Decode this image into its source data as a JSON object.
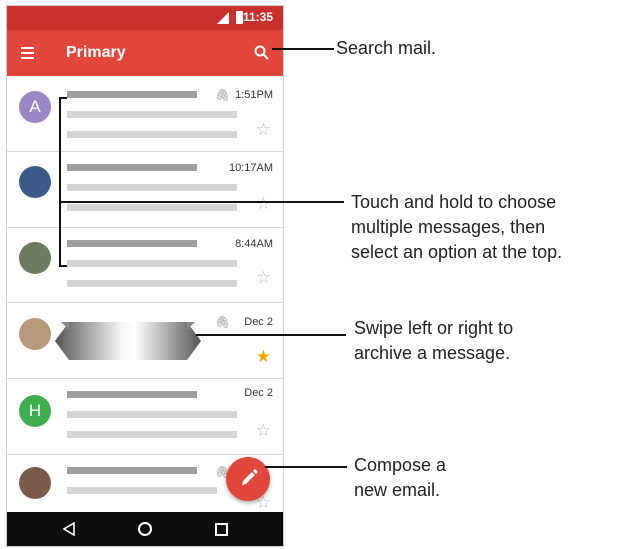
{
  "status_bar": {
    "time": "11:35"
  },
  "app_bar": {
    "title": "Primary",
    "menu_icon": "menu-icon",
    "search_icon": "search-icon"
  },
  "messages": [
    {
      "avatar_letter": "A",
      "avatar_color": "#9c87c6",
      "time": "1:51PM",
      "attachment": true,
      "starred": false
    },
    {
      "avatar_letter": "",
      "avatar_color": "#3b5a8a",
      "time": "10:17AM",
      "attachment": false,
      "starred": false
    },
    {
      "avatar_letter": "",
      "avatar_color": "#6b7d5e",
      "time": "8:44AM",
      "attachment": false,
      "starred": false
    },
    {
      "avatar_letter": "",
      "avatar_color": "#b89a7a",
      "time": "Dec 2",
      "attachment": true,
      "starred": true
    },
    {
      "avatar_letter": "H",
      "avatar_color": "#3fae4f",
      "time": "Dec 2",
      "attachment": false,
      "starred": false
    },
    {
      "avatar_letter": "",
      "avatar_color": "#7a5a48",
      "time": "",
      "attachment": true,
      "starred": false
    }
  ],
  "fab": {
    "icon": "pencil-icon"
  },
  "nav_bar": {
    "back_icon": "back-icon",
    "home_icon": "home-icon",
    "recent_icon": "recent-apps-icon"
  },
  "callouts": {
    "search": "Search mail.",
    "select": [
      "Touch and hold to choose",
      "multiple messages, then",
      "select an option at the top."
    ],
    "swipe": [
      "Swipe left or right to",
      "archive a message."
    ],
    "compose": [
      "Compose a",
      "new email."
    ]
  },
  "colors": {
    "status_bar": "#c9302c",
    "app_bar": "#e0463b",
    "accent": "#e0463b",
    "star_filled": "#f1a600"
  }
}
